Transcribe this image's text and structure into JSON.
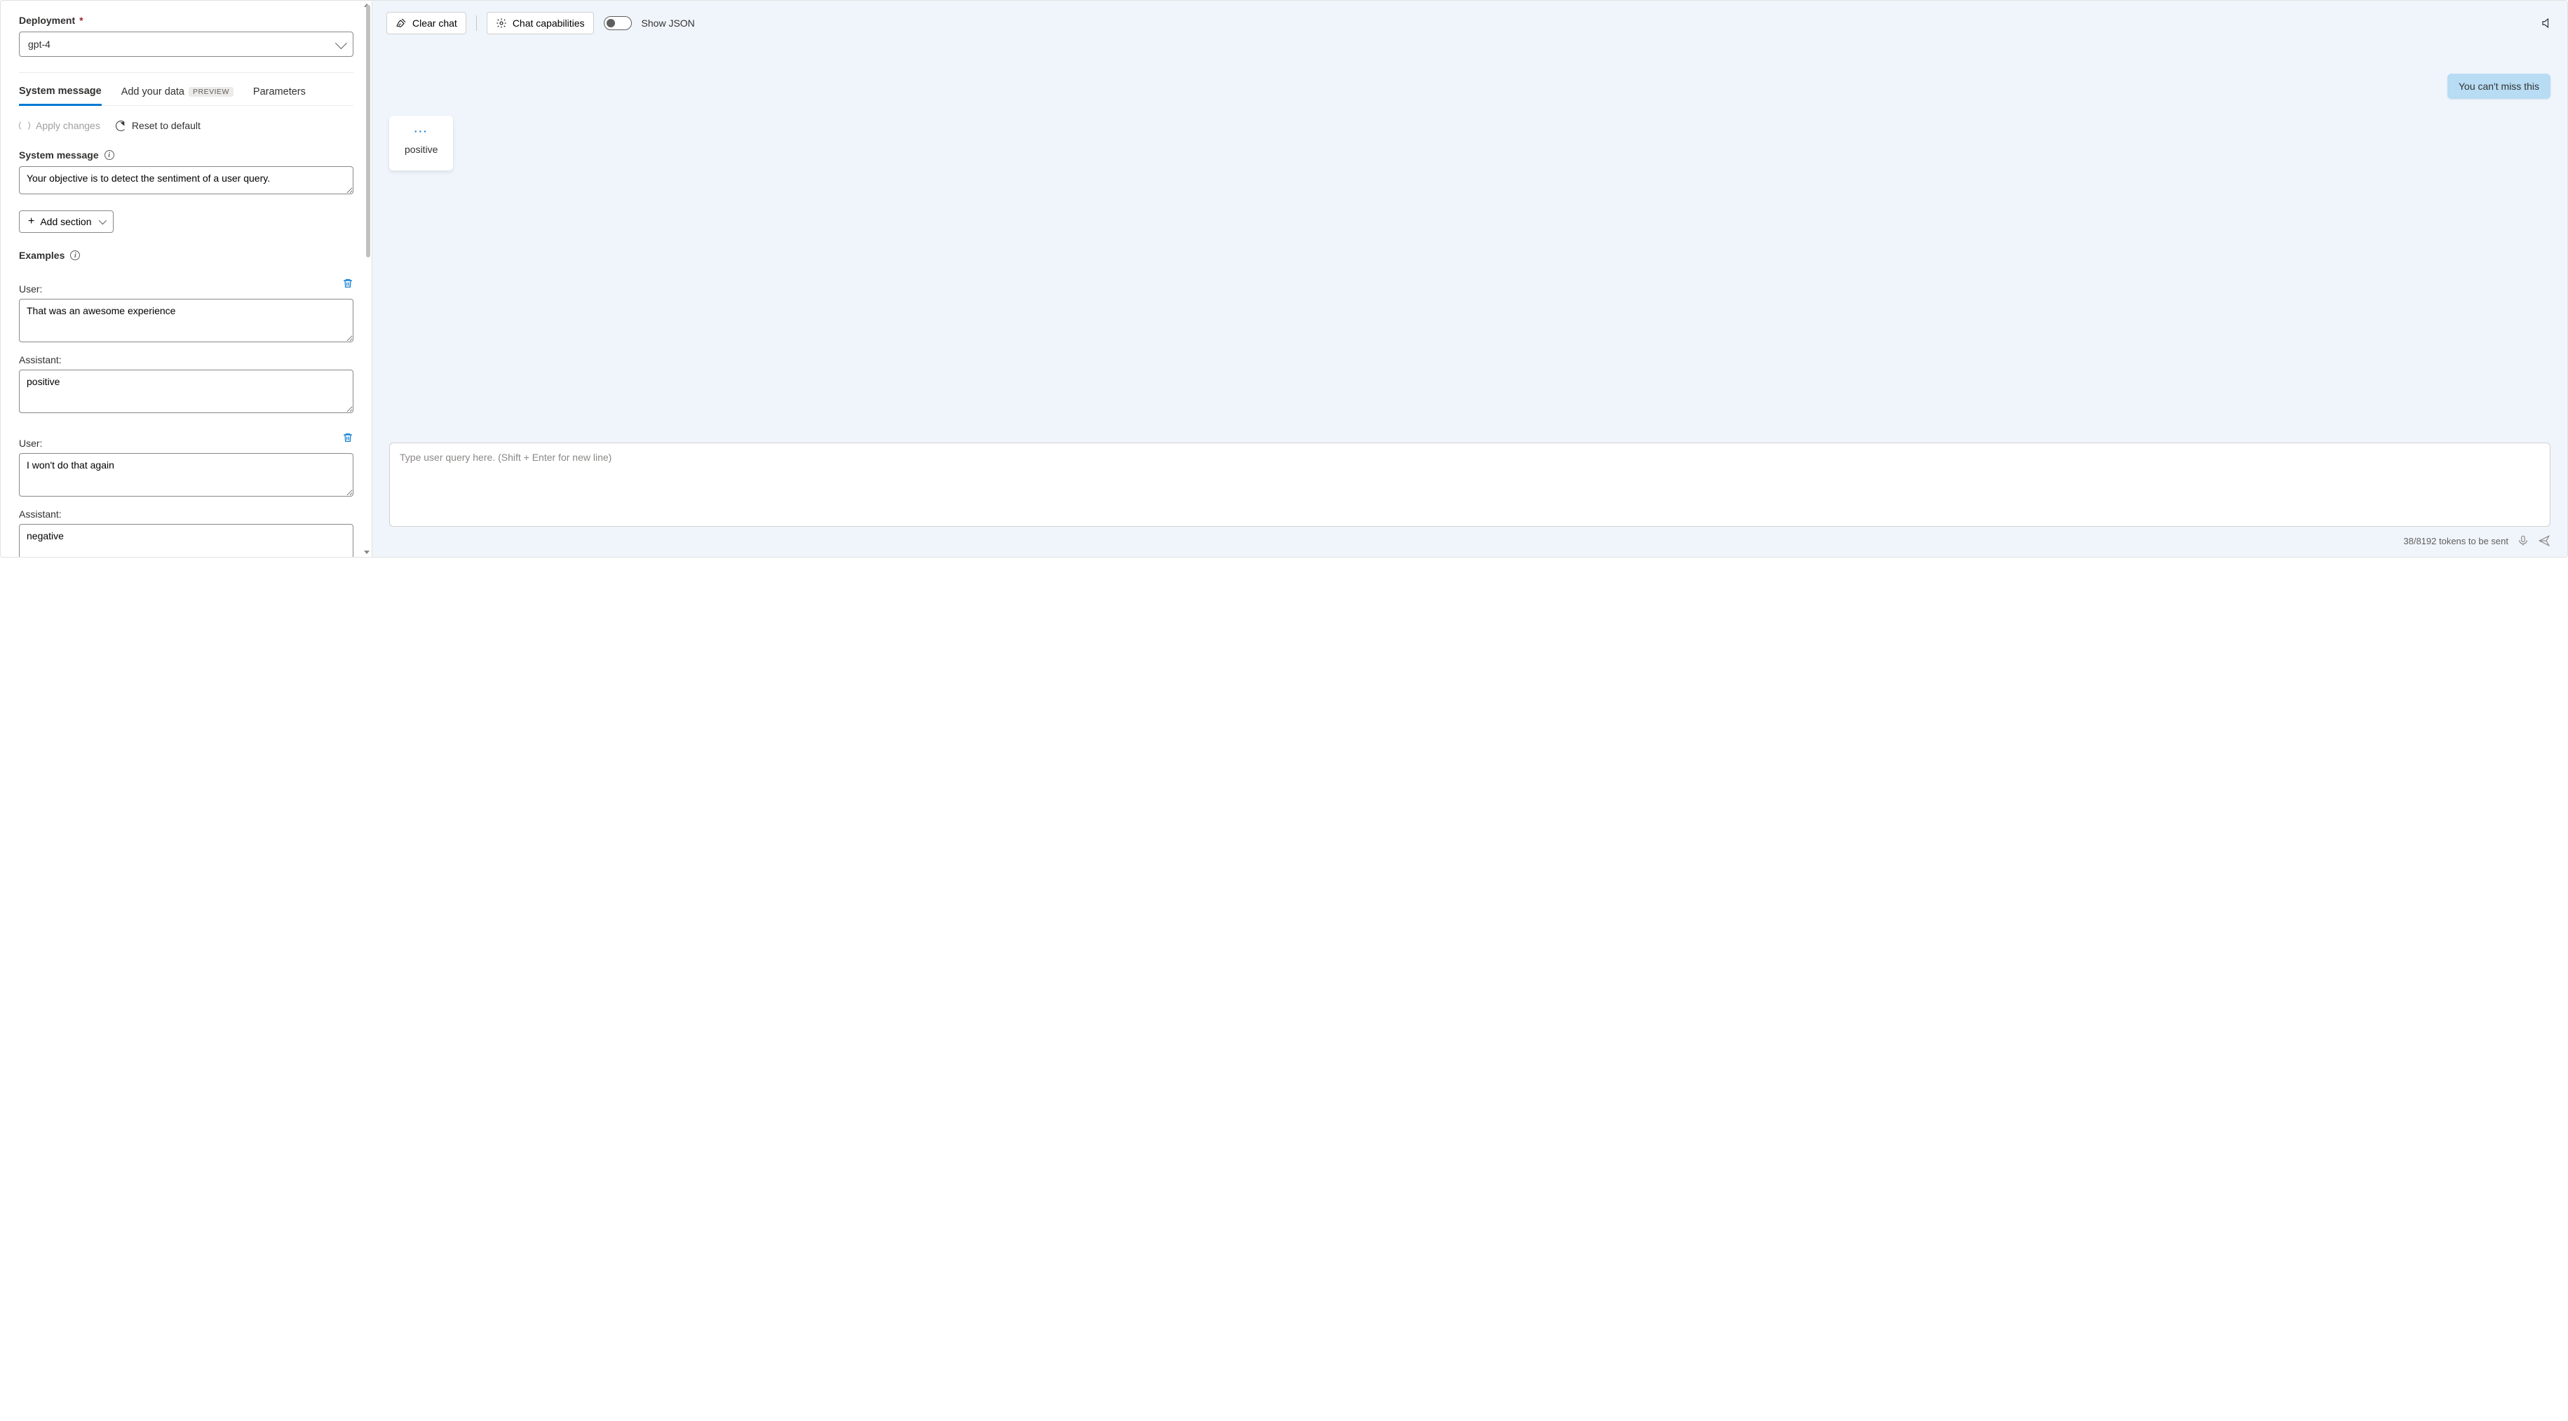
{
  "left": {
    "deployment_label": "Deployment",
    "deployment_value": "gpt-4",
    "tabs": {
      "system_message": "System message",
      "add_your_data": "Add your data",
      "preview_badge": "PREVIEW",
      "parameters": "Parameters"
    },
    "apply_changes": "Apply changes",
    "reset_default": "Reset to default",
    "system_message_label": "System message",
    "system_message_value": "Your objective is to detect the sentiment of a user query.",
    "add_section": "Add section",
    "examples_label": "Examples",
    "user_label": "User:",
    "assistant_label": "Assistant:",
    "examples": [
      {
        "user": "That was an awesome experience",
        "assistant": "positive"
      },
      {
        "user": "I won't do that again",
        "assistant": "negative"
      }
    ]
  },
  "right": {
    "clear_chat": "Clear chat",
    "chat_capabilities": "Chat capabilities",
    "show_json": "Show JSON",
    "user_message": "You can't miss this",
    "assistant_message": "positive",
    "query_placeholder": "Type user query here. (Shift + Enter for new line)",
    "token_status": "38/8192 tokens to be sent"
  }
}
